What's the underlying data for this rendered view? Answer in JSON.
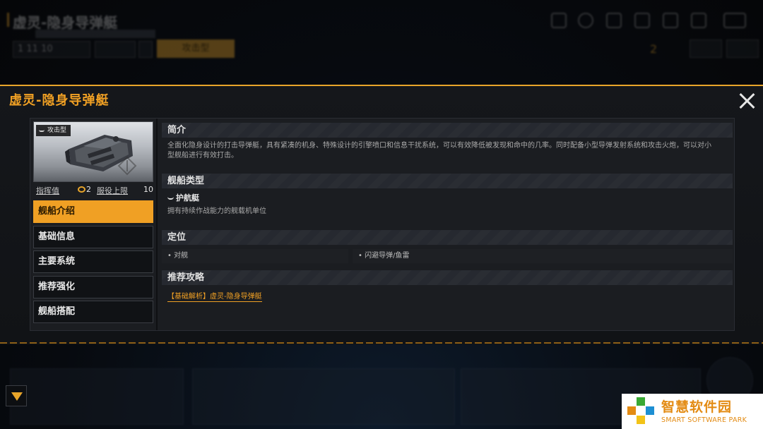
{
  "background": {
    "title": "虚灵-隐身导弹艇",
    "level_value": "1 11 10",
    "count_value": "2",
    "gold_button": "攻击型"
  },
  "modal": {
    "title": "虚灵-隐身导弹艇"
  },
  "ship_card": {
    "tag": "攻击型",
    "command_label": "指挥值",
    "command_value": "2",
    "limit_label": "服役上限",
    "limit_value": "10"
  },
  "menu": {
    "items": [
      {
        "label": "舰船介绍",
        "active": true
      },
      {
        "label": "基础信息",
        "active": false
      },
      {
        "label": "主要系统",
        "active": false
      },
      {
        "label": "推荐强化",
        "active": false
      },
      {
        "label": "舰船搭配",
        "active": false
      }
    ]
  },
  "sections": {
    "intro": {
      "heading": "简介",
      "line1": "全面化隐身设计的打击导弹艇，具有紧凑的机身、特殊设计的引擎喷口和信息干扰系统，可以有效降低被发现和命中的几率。同时配备小型导弹发射系统和攻击火炮，可以对小",
      "line2": "型舰船进行有效打击。"
    },
    "type": {
      "heading": "舰船类型",
      "type_name": "护航艇",
      "description": "拥有持续作战能力的舰载机单位"
    },
    "position": {
      "heading": "定位",
      "cells": [
        "• 对舰",
        "• 闪避导弹/鱼雷"
      ]
    },
    "strategy": {
      "heading": "推荐攻略",
      "link": "【基础解析】虚灵-隐身导弹艇"
    }
  },
  "watermark": {
    "cn": "智慧软件园",
    "en": "SMART SOFTWARE PARK"
  },
  "colors": {
    "accent": "#f0a024",
    "panel": "#1b1d21"
  }
}
